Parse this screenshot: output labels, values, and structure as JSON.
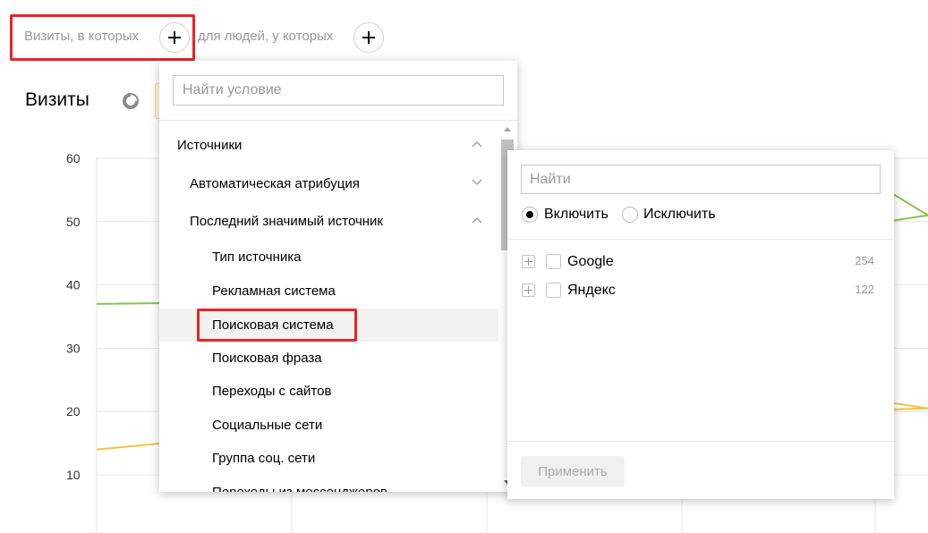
{
  "segment": {
    "visits_label": "Визиты, в которых",
    "people_label": "для людей, у которых"
  },
  "report": {
    "title": "Визиты"
  },
  "chart_data": {
    "type": "line",
    "title": "",
    "xlabel": "",
    "ylabel": "",
    "ylim": [
      0,
      62
    ],
    "yticks": [
      10,
      20,
      30,
      40,
      50,
      60
    ],
    "grid": true,
    "series": [
      {
        "color": "#8cc152",
        "x": [
          0,
          0.32,
          1
        ],
        "values": [
          37,
          37.5,
          51
        ]
      },
      {
        "color": "#f6c342",
        "x": [
          0,
          0.32,
          1
        ],
        "values": [
          14,
          18,
          20.5
        ]
      }
    ],
    "visible_right_values": [
      {
        "color": "#8cc152",
        "x": [
          0.95,
          1
        ],
        "values": [
          55,
          51
        ]
      },
      {
        "color": "#f6c342",
        "x": [
          0.95,
          1
        ],
        "values": [
          21.5,
          20.5
        ]
      }
    ]
  },
  "dropdown": {
    "search_placeholder": "Найти условие",
    "items": [
      {
        "label": "Источники",
        "level": 0,
        "chevron": "up"
      },
      {
        "label": "Автоматическая атрибуция",
        "level": 1,
        "chevron": "down"
      },
      {
        "label": "Последний значимый источник",
        "level": 1,
        "chevron": "up"
      },
      {
        "label": "Тип источника",
        "level": 2
      },
      {
        "label": "Рекламная система",
        "level": 2
      },
      {
        "label": "Поисковая система",
        "level": 2,
        "selected": true
      },
      {
        "label": "Поисковая фраза",
        "level": 2
      },
      {
        "label": "Переходы с сайтов",
        "level": 2
      },
      {
        "label": "Социальные сети",
        "level": 2
      },
      {
        "label": "Группа соц. сети",
        "level": 2
      },
      {
        "label": "Переходы из мессенджеров",
        "level": 2
      }
    ]
  },
  "subpanel": {
    "search_placeholder": "Найти",
    "include_label": "Включить",
    "exclude_label": "Исключить",
    "include_selected": true,
    "rows": [
      {
        "label": "Google",
        "count": "254"
      },
      {
        "label": "Яндекс",
        "count": "122"
      }
    ],
    "apply_label": "Применить"
  },
  "colors": {
    "highlight_frame": "#e8232a",
    "series_green": "#8cc152",
    "series_yellow": "#f6c342",
    "selected_row_bg": "#f2f2f0"
  }
}
